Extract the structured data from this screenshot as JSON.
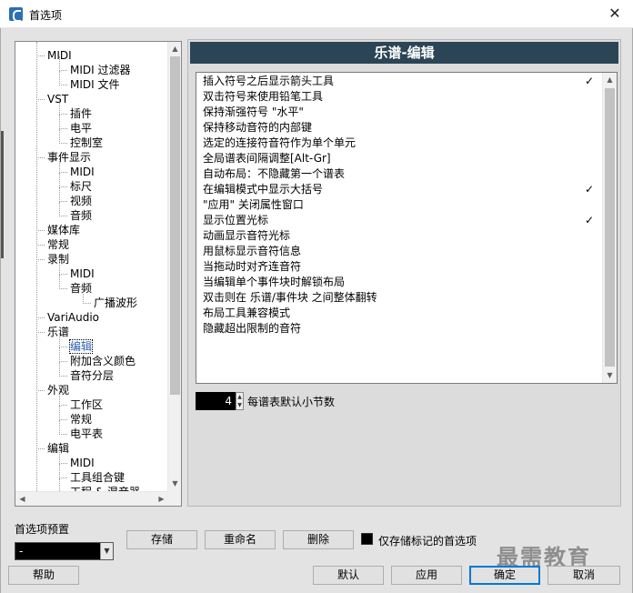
{
  "window": {
    "title": "首选项",
    "close_glyph": "✕"
  },
  "tree": {
    "items": [
      {
        "label": "MIDI",
        "level": 1
      },
      {
        "label": "MIDI 过滤器",
        "level": 2
      },
      {
        "label": "MIDI 文件",
        "level": 2
      },
      {
        "label": "VST",
        "level": 1
      },
      {
        "label": "插件",
        "level": 2
      },
      {
        "label": "电平",
        "level": 2
      },
      {
        "label": "控制室",
        "level": 2
      },
      {
        "label": "事件显示",
        "level": 1
      },
      {
        "label": "MIDI",
        "level": 2
      },
      {
        "label": "标尺",
        "level": 2
      },
      {
        "label": "视频",
        "level": 2
      },
      {
        "label": "音频",
        "level": 2
      },
      {
        "label": "媒体库",
        "level": 1
      },
      {
        "label": "常规",
        "level": 1
      },
      {
        "label": "录制",
        "level": 1
      },
      {
        "label": "MIDI",
        "level": 2
      },
      {
        "label": "音频",
        "level": 2
      },
      {
        "label": "广播波形",
        "level": 3
      },
      {
        "label": "VariAudio",
        "level": 1
      },
      {
        "label": "乐谱",
        "level": 1
      },
      {
        "label": "编辑",
        "level": 2,
        "selected": true
      },
      {
        "label": "附加含义颜色",
        "level": 2
      },
      {
        "label": "音符分层",
        "level": 2
      },
      {
        "label": "外观",
        "level": 1
      },
      {
        "label": "工作区",
        "level": 2
      },
      {
        "label": "常规",
        "level": 2
      },
      {
        "label": "电平表",
        "level": 2
      },
      {
        "label": "编辑",
        "level": 1
      },
      {
        "label": "MIDI",
        "level": 2
      },
      {
        "label": "工具组合键",
        "level": 2
      },
      {
        "label": "工程 & 混音器",
        "level": 2
      }
    ],
    "scroll_up": "▲",
    "scroll_down": "▼",
    "scroll_left": "◀",
    "scroll_right": "▶"
  },
  "panel": {
    "header": "乐谱-编辑",
    "options": [
      {
        "label": "插入符号之后显示箭头工具",
        "checked": true
      },
      {
        "label": "双击符号来使用铅笔工具",
        "checked": false
      },
      {
        "label": "保持渐强符号 \"水平\"",
        "checked": false
      },
      {
        "label": "保持移动音符的内部键",
        "checked": false
      },
      {
        "label": "选定的连接符音符作为单个单元",
        "checked": false
      },
      {
        "label": "全局谱表间隔调整[Alt-Gr]",
        "checked": false
      },
      {
        "label": "自动布局：不隐藏第一个谱表",
        "checked": false
      },
      {
        "label": "在编辑模式中显示大括号",
        "checked": true
      },
      {
        "label": "\"应用\" 关闭属性窗口",
        "checked": false
      },
      {
        "label": "显示位置光标",
        "checked": true
      },
      {
        "label": "动画显示音符光标",
        "checked": false
      },
      {
        "label": "用鼠标显示音符信息",
        "checked": false
      },
      {
        "label": "当拖动时对齐连音符",
        "checked": false
      },
      {
        "label": "当编辑单个事件块时解锁布局",
        "checked": false
      },
      {
        "label": "双击则在 乐谱/事件块 之间整体翻转",
        "checked": false
      },
      {
        "label": "布局工具兼容模式",
        "checked": false
      },
      {
        "label": "隐藏超出限制的音符",
        "checked": false
      }
    ],
    "check_glyph": "✓",
    "bars_value": "4",
    "bars_label": "每谱表默认小节数",
    "spin_up": "▲",
    "spin_down": "▼"
  },
  "presets": {
    "label": "首选项预置",
    "value": "-",
    "combo_arrow": "▼",
    "store": "存储",
    "rename": "重命名",
    "delete": "删除",
    "only_marked_label": "仅存储标记的首选项",
    "only_marked_checked": false
  },
  "footer": {
    "help": "帮助",
    "default": "默认",
    "apply": "应用",
    "ok": "确定",
    "cancel": "取消"
  },
  "watermark": "最需教育"
}
